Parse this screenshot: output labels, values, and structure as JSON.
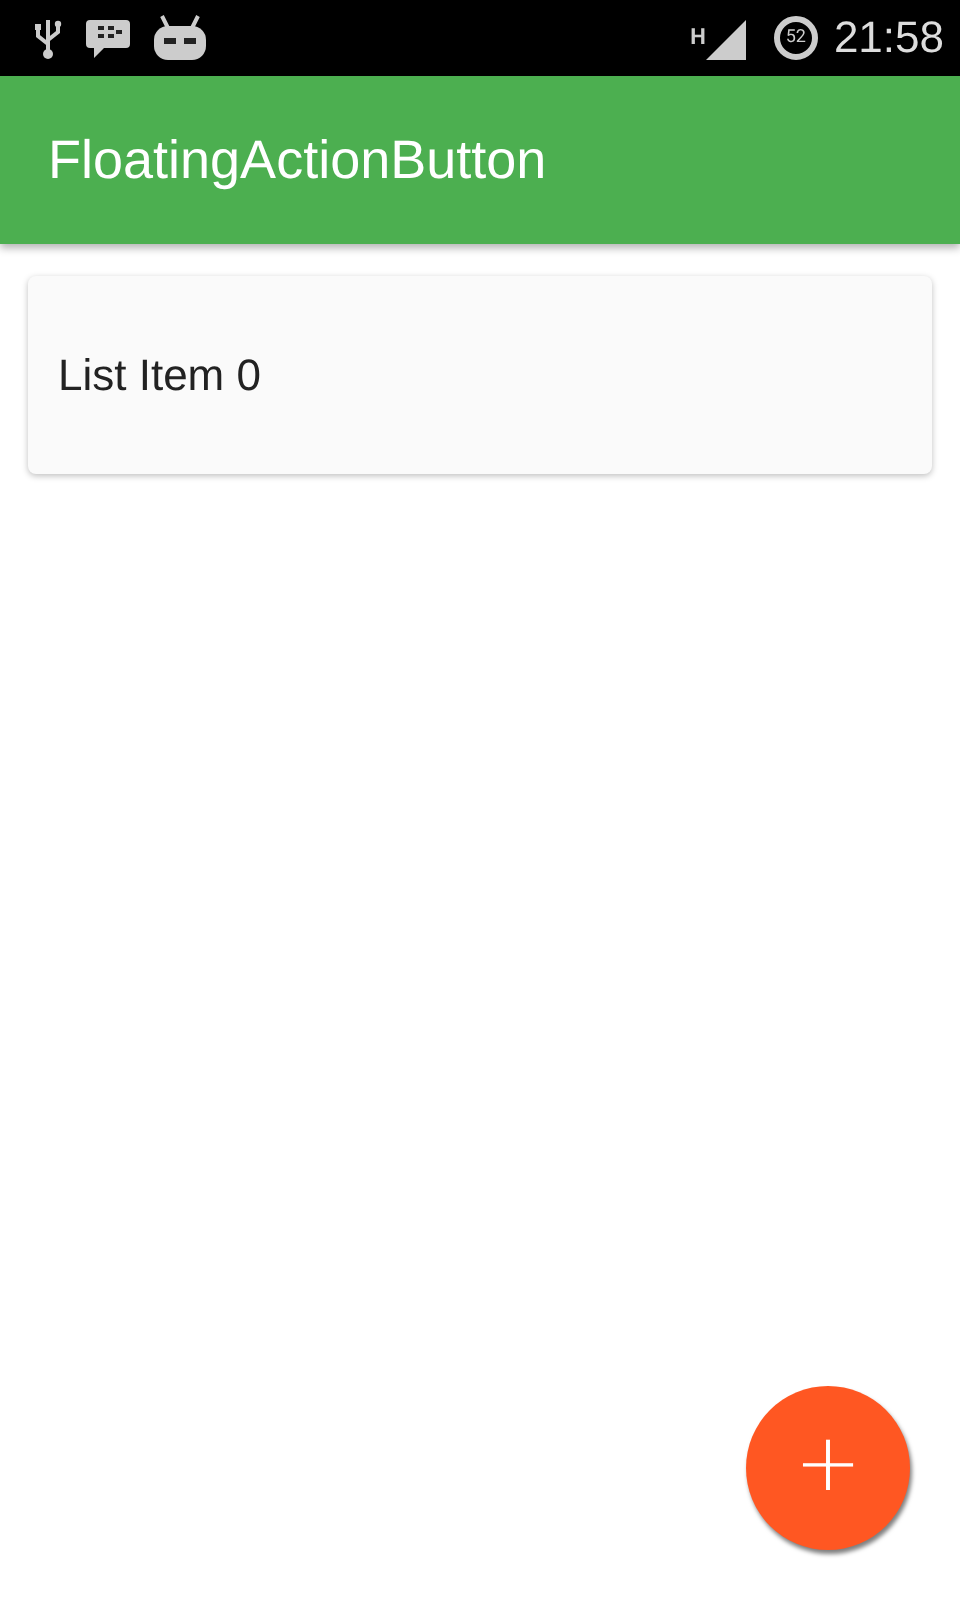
{
  "status_bar": {
    "network_type": "H",
    "battery": "52",
    "time": "21:58"
  },
  "app_bar": {
    "title": "FloatingActionButton"
  },
  "list": [
    {
      "label": "List Item 0"
    }
  ],
  "fab": {
    "label": "+"
  }
}
